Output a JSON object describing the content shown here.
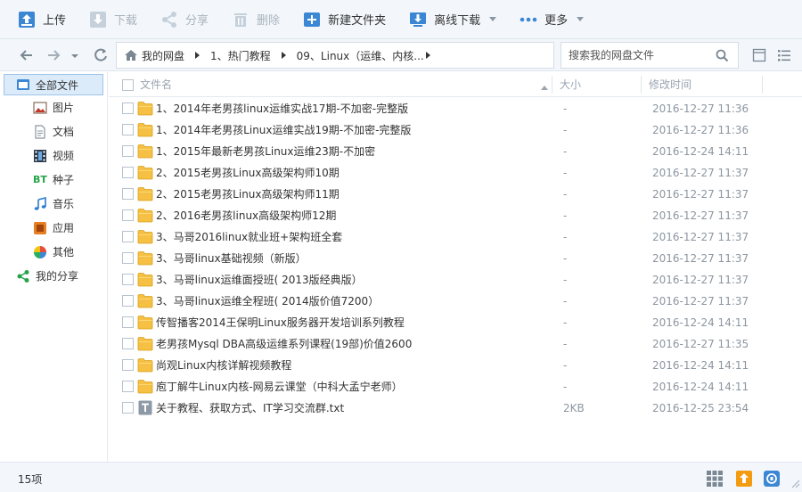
{
  "toolbar": {
    "upload": "上传",
    "download": "下载",
    "share": "分享",
    "delete": "删除",
    "new_folder": "新建文件夹",
    "offline_download": "离线下载",
    "more": "更多"
  },
  "breadcrumb": {
    "items": [
      "我的网盘",
      "1、热门教程",
      "09、Linux（运维、内核..."
    ]
  },
  "search": {
    "placeholder": "搜索我的网盘文件"
  },
  "sidebar": {
    "items": [
      {
        "label": "全部文件",
        "icon": "folder-icon"
      },
      {
        "label": "图片",
        "icon": "image-icon"
      },
      {
        "label": "文档",
        "icon": "document-icon"
      },
      {
        "label": "视频",
        "icon": "video-icon"
      },
      {
        "label": "种子",
        "icon": "bt-icon"
      },
      {
        "label": "音乐",
        "icon": "music-icon"
      },
      {
        "label": "应用",
        "icon": "app-icon"
      },
      {
        "label": "其他",
        "icon": "other-icon"
      },
      {
        "label": "我的分享",
        "icon": "share-icon"
      }
    ]
  },
  "columns": {
    "name": "文件名",
    "size": "大小",
    "modified": "修改时间"
  },
  "files": [
    {
      "name": "1、2014年老男孩linux运维实战17期-不加密-完整版",
      "size": "-",
      "date": "2016-12-27 11:36",
      "type": "folder"
    },
    {
      "name": "1、2014年老男孩Linux运维实战19期-不加密-完整版",
      "size": "-",
      "date": "2016-12-27 11:36",
      "type": "folder"
    },
    {
      "name": "1、2015年最新老男孩Linux运维23期-不加密",
      "size": "-",
      "date": "2016-12-24 14:11",
      "type": "folder"
    },
    {
      "name": "2、2015老男孩Linux高级架构师10期",
      "size": "-",
      "date": "2016-12-27 11:37",
      "type": "folder"
    },
    {
      "name": "2、2015老男孩Linux高级架构师11期",
      "size": "-",
      "date": "2016-12-27 11:37",
      "type": "folder"
    },
    {
      "name": "2、2016老男孩linux高级架构师12期",
      "size": "-",
      "date": "2016-12-27 11:37",
      "type": "folder"
    },
    {
      "name": "3、马哥2016linux就业班+架构班全套",
      "size": "-",
      "date": "2016-12-27 11:37",
      "type": "folder"
    },
    {
      "name": "3、马哥linux基础视频（新版）",
      "size": "-",
      "date": "2016-12-27 11:37",
      "type": "folder"
    },
    {
      "name": "3、马哥linux运维面授班( 2013版经典版）",
      "size": "-",
      "date": "2016-12-27 11:37",
      "type": "folder"
    },
    {
      "name": "3、马哥linux运维全程班( 2014版价值7200）",
      "size": "-",
      "date": "2016-12-27 11:37",
      "type": "folder"
    },
    {
      "name": "传智播客2014王保明Linux服务器开发培训系列教程",
      "size": "-",
      "date": "2016-12-24 14:11",
      "type": "folder"
    },
    {
      "name": "老男孩Mysql DBA高级运维系列课程(19部)价值2600",
      "size": "-",
      "date": "2016-12-27 11:35",
      "type": "folder"
    },
    {
      "name": "尚观Linux内核详解视频教程",
      "size": "-",
      "date": "2016-12-24 14:11",
      "type": "folder"
    },
    {
      "name": "庖丁解牛Linux内核-网易云课堂（中科大孟宁老师）",
      "size": "-",
      "date": "2016-12-24 14:11",
      "type": "folder"
    },
    {
      "name": "关于教程、获取方式、IT学习交流群.txt",
      "size": "2KB",
      "date": "2016-12-25 23:54",
      "type": "text"
    }
  ],
  "status": {
    "count_text": "15项"
  },
  "colors": {
    "folder": "#f5c043",
    "accent": "#2b7bd2",
    "date": "#8c96a0"
  }
}
